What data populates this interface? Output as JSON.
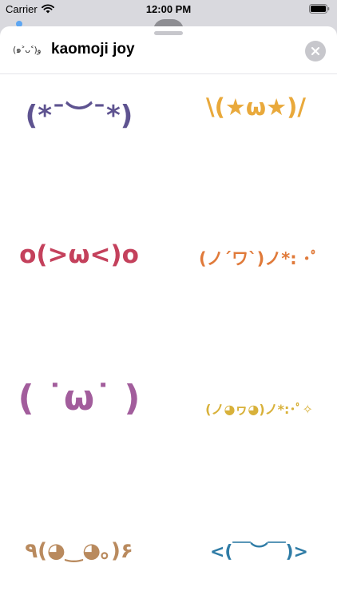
{
  "status_bar": {
    "carrier": "Carrier",
    "time": "12:00 PM"
  },
  "header": {
    "logo": "(๑˃ᴗ˂)ﻭ",
    "title": "kaomoji joy",
    "close_icon": "close-icon"
  },
  "stickers": [
    {
      "text": "(*¯︶¯*)",
      "color": "#5e5390"
    },
    {
      "text": "\\(★ω★)/",
      "color": "#e9a93b"
    },
    {
      "text": "o(>ω<)o",
      "color": "#c4415c"
    },
    {
      "text": "(ノ´ワ`)ノ*: ･ﾟ",
      "color": "#e07a3a"
    },
    {
      "text": "( ˙ω˙ )",
      "color": "#a25d9c"
    },
    {
      "text": "(ノ◕ヮ◕)ノ*:･ﾟ✧",
      "color": "#d8b13a"
    },
    {
      "text": "٩(◕‿◕｡)۶",
      "color": "#b98a5e"
    },
    {
      "text": "<(￣︶￣)>",
      "color": "#2f7ca6"
    }
  ]
}
